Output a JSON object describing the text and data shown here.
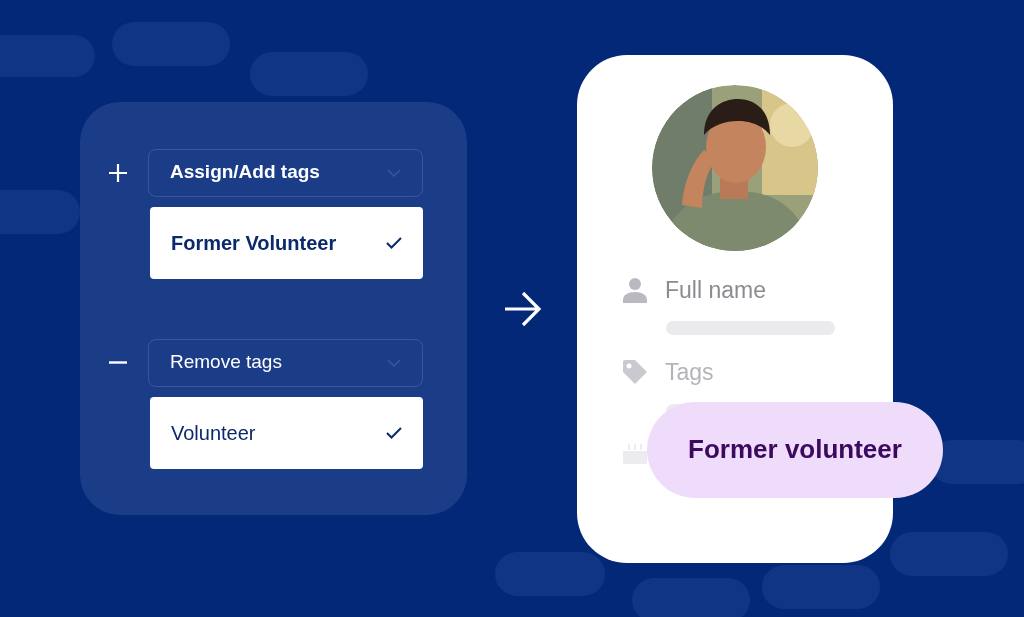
{
  "tag_actions": [
    {
      "kind": "add",
      "label": "Assign/Add tags",
      "option": "Former Volunteer",
      "checked": true
    },
    {
      "kind": "remove",
      "label": "Remove tags",
      "option": "Volunteer",
      "checked": true
    }
  ],
  "profile_card": {
    "fields": [
      {
        "kind": "person",
        "label": "Full name"
      },
      {
        "kind": "tag",
        "label": "Tags"
      },
      {
        "kind": "cake"
      }
    ]
  },
  "tag_badge": {
    "label": "Former volunteer"
  }
}
